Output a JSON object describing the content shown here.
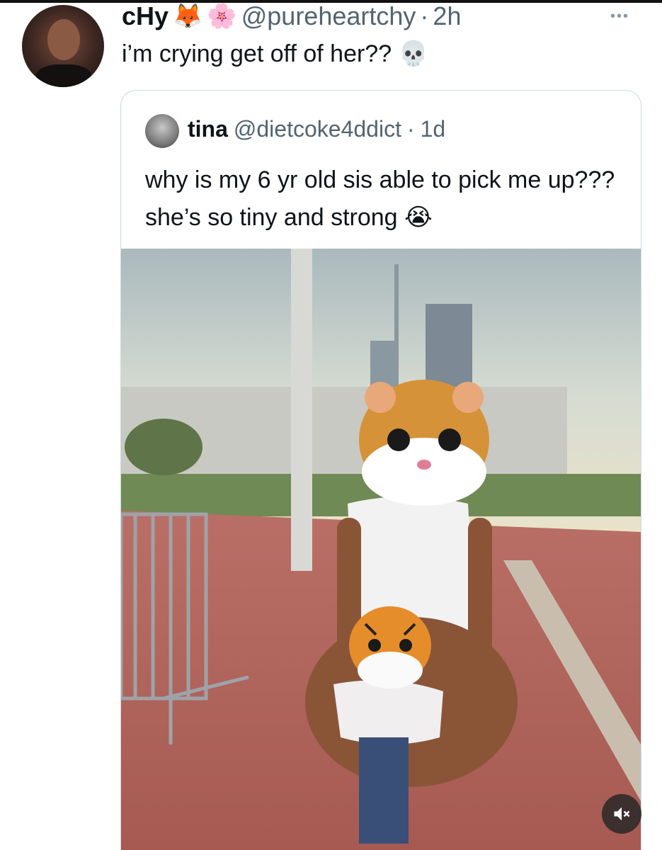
{
  "tweet": {
    "name": "cHy",
    "name_emojis": [
      "🦊",
      "🌸"
    ],
    "handle": "@pureheartchy",
    "dot": "·",
    "time": "2h",
    "text": "i’m crying get off of her??",
    "text_emoji": "💀",
    "more_label": "•••"
  },
  "quote": {
    "name": "tina",
    "handle": "@dietcoke4ddict",
    "dot": "·",
    "time": "1d",
    "text": "why is my 6 yr old sis able to pick me up??? she’s so tiny and strong",
    "text_emoji": "😭"
  },
  "media": {
    "mute_icon": "speaker-muted-icon"
  },
  "colors": {
    "text": "#0f1419",
    "secondary": "#536471",
    "border": "#cfd9de"
  }
}
